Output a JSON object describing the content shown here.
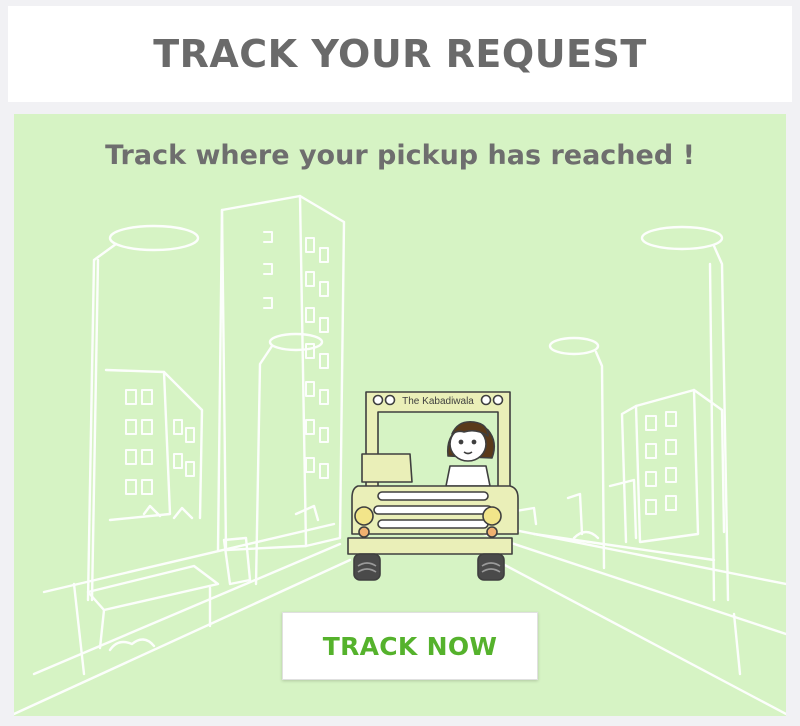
{
  "header": {
    "title": "TRACK YOUR REQUEST"
  },
  "banner": {
    "tagline": "Track where your pickup has reached !",
    "truck_label": "The Kabadiwala",
    "button_label": "TRACK NOW"
  },
  "colors": {
    "background": "#f1f1f4",
    "banner": "#d6f3c4",
    "button_text": "#55b22c",
    "heading_text": "#6a6a6a",
    "truck_body": "#eaefb8"
  }
}
